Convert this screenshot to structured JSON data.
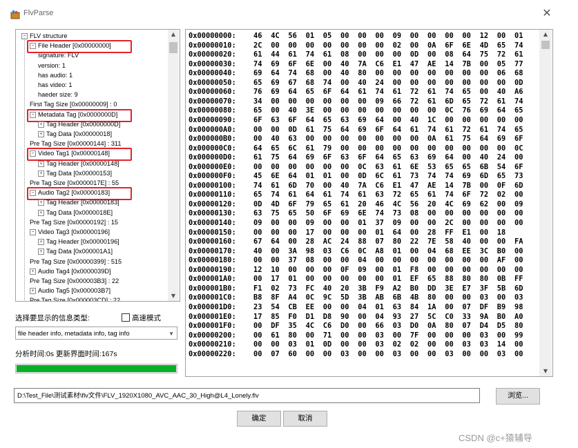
{
  "window": {
    "title": "FlvParse",
    "close_glyph": "✕"
  },
  "tree": {
    "nodes": [
      {
        "label": "FLV structure",
        "box": "−"
      },
      {
        "label": "File Header [0x00000000]",
        "box": "−"
      },
      {
        "label": "signature: FLV"
      },
      {
        "label": "version: 1"
      },
      {
        "label": "has audio: 1"
      },
      {
        "label": "has video: 1"
      },
      {
        "label": "haeder size: 9"
      },
      {
        "label": "First Tag Size [0x00000009] : 0"
      },
      {
        "label": "Metadata Tag [0x0000000D]",
        "box": "−"
      },
      {
        "label": "Tag Header [0x0000000D]",
        "box": "+"
      },
      {
        "label": "Tag Data [0x00000018]",
        "box": "+"
      },
      {
        "label": "Pre Tag Size [0x00000144] : 311"
      },
      {
        "label": "Video Tag1 [0x00000148]",
        "box": "−"
      },
      {
        "label": "Tag Header [0x00000148]",
        "box": "+"
      },
      {
        "label": "Tag Data [0x00000153]",
        "box": "+"
      },
      {
        "label": "Pre Tag Size [0x0000017E] : 55"
      },
      {
        "label": "Audio Tag2 [0x00000183]",
        "box": "−"
      },
      {
        "label": "Tag Header [0x00000183]",
        "box": "+"
      },
      {
        "label": "Tag Data [0x0000018E]",
        "box": "+"
      },
      {
        "label": "Pre Tag Size [0x00000192] : 15"
      },
      {
        "label": "Video Tag3 [0x00000196]",
        "box": "−"
      },
      {
        "label": "Tag Header [0x00000196]",
        "box": "+"
      },
      {
        "label": "Tag Data [0x000001A1]",
        "box": "+"
      },
      {
        "label": "Pre Tag Size [0x00000399] : 515"
      },
      {
        "label": "Audio Tag4 [0x0000039D]",
        "box": "+"
      },
      {
        "label": "Pre Tag Size [0x000003B3] : 22"
      },
      {
        "label": "Audio Tag5 [0x000003B7]",
        "box": "+"
      },
      {
        "label": "Pre Tag Size [0x000003CD] : 22"
      }
    ],
    "scroll_up": "▲",
    "scroll_down": "▼"
  },
  "hex": {
    "rows": [
      {
        "addr": "0x00000000:",
        "bytes": [
          "46",
          "4C",
          "56",
          "01",
          "05",
          "00",
          "00",
          "00",
          "09",
          "00",
          "00",
          "00",
          "00",
          "12",
          "00",
          "01"
        ]
      },
      {
        "addr": "0x00000010:",
        "bytes": [
          "2C",
          "00",
          "00",
          "00",
          "00",
          "00",
          "00",
          "00",
          "02",
          "00",
          "0A",
          "6F",
          "6E",
          "4D",
          "65",
          "74"
        ]
      },
      {
        "addr": "0x00000020:",
        "bytes": [
          "61",
          "44",
          "61",
          "74",
          "61",
          "08",
          "00",
          "00",
          "00",
          "0D",
          "00",
          "08",
          "64",
          "75",
          "72",
          "61"
        ]
      },
      {
        "addr": "0x00000030:",
        "bytes": [
          "74",
          "69",
          "6F",
          "6E",
          "00",
          "40",
          "7A",
          "C6",
          "E1",
          "47",
          "AE",
          "14",
          "7B",
          "00",
          "05",
          "77"
        ]
      },
      {
        "addr": "0x00000040:",
        "bytes": [
          "69",
          "64",
          "74",
          "68",
          "00",
          "40",
          "80",
          "00",
          "00",
          "00",
          "00",
          "00",
          "00",
          "00",
          "06",
          "68"
        ]
      },
      {
        "addr": "0x00000050:",
        "bytes": [
          "65",
          "69",
          "67",
          "68",
          "74",
          "00",
          "40",
          "24",
          "00",
          "00",
          "00",
          "00",
          "00",
          "00",
          "00",
          "0D"
        ]
      },
      {
        "addr": "0x00000060:",
        "bytes": [
          "76",
          "69",
          "64",
          "65",
          "6F",
          "64",
          "61",
          "74",
          "61",
          "72",
          "61",
          "74",
          "65",
          "00",
          "40",
          "A6"
        ]
      },
      {
        "addr": "0x00000070:",
        "bytes": [
          "34",
          "00",
          "00",
          "00",
          "00",
          "00",
          "00",
          "09",
          "66",
          "72",
          "61",
          "6D",
          "65",
          "72",
          "61",
          "74"
        ]
      },
      {
        "addr": "0x00000080:",
        "bytes": [
          "65",
          "00",
          "40",
          "3E",
          "00",
          "00",
          "00",
          "00",
          "00",
          "00",
          "00",
          "0C",
          "76",
          "69",
          "64",
          "65"
        ]
      },
      {
        "addr": "0x00000090:",
        "bytes": [
          "6F",
          "63",
          "6F",
          "64",
          "65",
          "63",
          "69",
          "64",
          "00",
          "40",
          "1C",
          "00",
          "00",
          "00",
          "00",
          "00"
        ]
      },
      {
        "addr": "0x000000A0:",
        "bytes": [
          "00",
          "00",
          "0D",
          "61",
          "75",
          "64",
          "69",
          "6F",
          "64",
          "61",
          "74",
          "61",
          "72",
          "61",
          "74",
          "65"
        ]
      },
      {
        "addr": "0x000000B0:",
        "bytes": [
          "00",
          "40",
          "63",
          "00",
          "00",
          "00",
          "00",
          "00",
          "00",
          "00",
          "0A",
          "61",
          "75",
          "64",
          "69",
          "6F"
        ]
      },
      {
        "addr": "0x000000C0:",
        "bytes": [
          "64",
          "65",
          "6C",
          "61",
          "79",
          "00",
          "00",
          "00",
          "00",
          "00",
          "00",
          "00",
          "00",
          "00",
          "00",
          "0C"
        ]
      },
      {
        "addr": "0x000000D0:",
        "bytes": [
          "61",
          "75",
          "64",
          "69",
          "6F",
          "63",
          "6F",
          "64",
          "65",
          "63",
          "69",
          "64",
          "00",
          "40",
          "24",
          "00"
        ]
      },
      {
        "addr": "0x000000E0:",
        "bytes": [
          "00",
          "00",
          "00",
          "00",
          "00",
          "00",
          "0C",
          "63",
          "61",
          "6E",
          "53",
          "65",
          "65",
          "6B",
          "54",
          "6F"
        ]
      },
      {
        "addr": "0x000000F0:",
        "bytes": [
          "45",
          "6E",
          "64",
          "01",
          "01",
          "00",
          "0D",
          "6C",
          "61",
          "73",
          "74",
          "74",
          "69",
          "6D",
          "65",
          "73"
        ]
      },
      {
        "addr": "0x00000100:",
        "bytes": [
          "74",
          "61",
          "6D",
          "70",
          "00",
          "40",
          "7A",
          "C6",
          "E1",
          "47",
          "AE",
          "14",
          "7B",
          "00",
          "0F",
          "6D"
        ]
      },
      {
        "addr": "0x00000110:",
        "bytes": [
          "65",
          "74",
          "61",
          "64",
          "61",
          "74",
          "61",
          "63",
          "72",
          "65",
          "61",
          "74",
          "6F",
          "72",
          "02",
          "00"
        ]
      },
      {
        "addr": "0x00000120:",
        "bytes": [
          "0D",
          "4D",
          "6F",
          "79",
          "65",
          "61",
          "20",
          "46",
          "4C",
          "56",
          "20",
          "4C",
          "69",
          "62",
          "00",
          "09"
        ]
      },
      {
        "addr": "0x00000130:",
        "bytes": [
          "63",
          "75",
          "65",
          "50",
          "6F",
          "69",
          "6E",
          "74",
          "73",
          "08",
          "00",
          "00",
          "00",
          "00",
          "00",
          "00"
        ]
      },
      {
        "addr": "0x00000140:",
        "bytes": [
          "09",
          "00",
          "00",
          "09",
          "00",
          "00",
          "01",
          "37",
          "09",
          "00",
          "00",
          "2C",
          "00",
          "00",
          "00",
          "00"
        ]
      },
      {
        "addr": "0x00000150:",
        "bytes": [
          "00",
          "00",
          "00",
          "17",
          "00",
          "00",
          "00",
          "01",
          "64",
          "00",
          "28",
          "FF",
          "E1",
          "00",
          "18"
        ]
      },
      {
        "addr": "0x00000160:",
        "bytes": [
          "67",
          "64",
          "00",
          "28",
          "AC",
          "24",
          "88",
          "07",
          "80",
          "22",
          "7E",
          "58",
          "40",
          "00",
          "00",
          "FA"
        ]
      },
      {
        "addr": "0x00000170:",
        "bytes": [
          "40",
          "00",
          "3A",
          "98",
          "03",
          "C6",
          "0C",
          "A8",
          "01",
          "00",
          "04",
          "68",
          "EE",
          "3C",
          "B0",
          "00"
        ]
      },
      {
        "addr": "0x00000180:",
        "bytes": [
          "00",
          "00",
          "37",
          "08",
          "00",
          "00",
          "04",
          "00",
          "00",
          "00",
          "00",
          "00",
          "00",
          "00",
          "AF",
          "00"
        ]
      },
      {
        "addr": "0x00000190:",
        "bytes": [
          "12",
          "10",
          "00",
          "00",
          "00",
          "0F",
          "09",
          "00",
          "01",
          "F8",
          "00",
          "00",
          "00",
          "00",
          "00",
          "00"
        ]
      },
      {
        "addr": "0x000001A0:",
        "bytes": [
          "00",
          "17",
          "01",
          "00",
          "00",
          "00",
          "00",
          "00",
          "01",
          "EF",
          "65",
          "88",
          "80",
          "80",
          "0B",
          "FF"
        ]
      },
      {
        "addr": "0x000001B0:",
        "bytes": [
          "F1",
          "02",
          "73",
          "FC",
          "40",
          "20",
          "3B",
          "F9",
          "A2",
          "B0",
          "DD",
          "3E",
          "E7",
          "3F",
          "5B",
          "6D"
        ]
      },
      {
        "addr": "0x000001C0:",
        "bytes": [
          "B8",
          "8F",
          "A4",
          "0C",
          "9C",
          "5D",
          "3B",
          "AB",
          "6B",
          "4B",
          "80",
          "00",
          "00",
          "03",
          "00",
          "03"
        ]
      },
      {
        "addr": "0x000001D0:",
        "bytes": [
          "23",
          "54",
          "CB",
          "EE",
          "00",
          "00",
          "04",
          "01",
          "63",
          "84",
          "1A",
          "00",
          "07",
          "DF",
          "B9",
          "98"
        ]
      },
      {
        "addr": "0x000001E0:",
        "bytes": [
          "17",
          "85",
          "F0",
          "D1",
          "D8",
          "90",
          "00",
          "04",
          "93",
          "27",
          "5C",
          "C0",
          "33",
          "9A",
          "B0",
          "A0"
        ]
      },
      {
        "addr": "0x000001F0:",
        "bytes": [
          "00",
          "DF",
          "35",
          "4C",
          "C6",
          "D0",
          "00",
          "66",
          "03",
          "D0",
          "0A",
          "80",
          "07",
          "D4",
          "D5",
          "80"
        ]
      },
      {
        "addr": "0x00000200:",
        "bytes": [
          "00",
          "61",
          "80",
          "00",
          "71",
          "00",
          "00",
          "03",
          "00",
          "7F",
          "00",
          "00",
          "00",
          "03",
          "00",
          "99"
        ]
      },
      {
        "addr": "0x00000210:",
        "bytes": [
          "00",
          "00",
          "03",
          "01",
          "0D",
          "00",
          "00",
          "03",
          "02",
          "02",
          "00",
          "00",
          "03",
          "03",
          "14",
          "00"
        ]
      },
      {
        "addr": "0x00000220:",
        "bytes": [
          "00",
          "07",
          "60",
          "00",
          "00",
          "03",
          "00",
          "00",
          "03",
          "00",
          "00",
          "03",
          "00",
          "00",
          "03",
          "00"
        ]
      }
    ]
  },
  "options": {
    "info_type_label": "选择要显示的信息类型:",
    "fast_mode_label": "高速模式",
    "fast_mode_checked": false,
    "select_value": "file header info, metadata info, tag info"
  },
  "status": {
    "text": "分析时间:0s   更新界面时间:167s",
    "progress_percent": 100
  },
  "file": {
    "path": "D:\\Test_File\\测试素材\\flv文件\\FLV_1920X1080_AVC_AAC_30_High@L4_Lonely.flv",
    "browse_label": "浏览..."
  },
  "actions": {
    "ok_label": "确定",
    "cancel_label": "取消"
  },
  "watermark": "CSDN @c+猿辅导"
}
